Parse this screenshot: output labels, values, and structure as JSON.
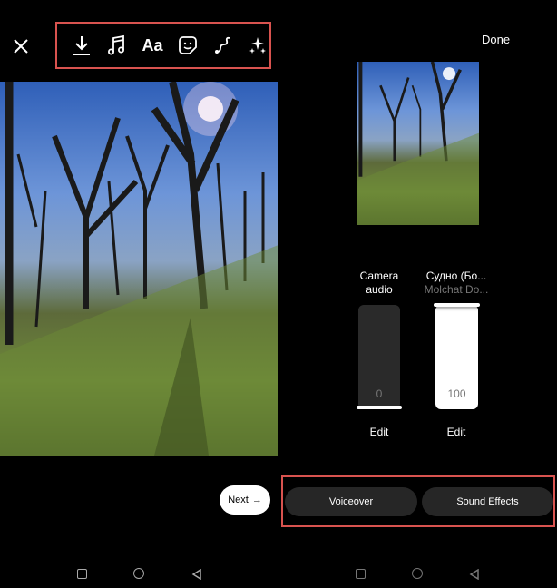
{
  "editor": {
    "toolbar": [
      {
        "icon": "download-icon"
      },
      {
        "icon": "music-icon"
      },
      {
        "icon": "text-icon",
        "label": "Aa"
      },
      {
        "icon": "sticker-icon"
      },
      {
        "icon": "draw-icon"
      },
      {
        "icon": "effects-sparkle-icon"
      }
    ],
    "next_label": "Next",
    "next_arrow": "→"
  },
  "audio": {
    "done_label": "Done",
    "tracks": [
      {
        "title": "Camera",
        "title2": "audio",
        "volume": "0",
        "volume_value": 0,
        "edit_label": "Edit"
      },
      {
        "title": "Судно (Бо...",
        "subtitle": "Molchat Do...",
        "volume": "100",
        "volume_value": 100,
        "edit_label": "Edit"
      }
    ],
    "buttons": {
      "voiceover": "Voiceover",
      "sound_effects": "Sound Effects"
    }
  },
  "colors": {
    "highlight": "#d9534f",
    "panel": "#262626"
  }
}
